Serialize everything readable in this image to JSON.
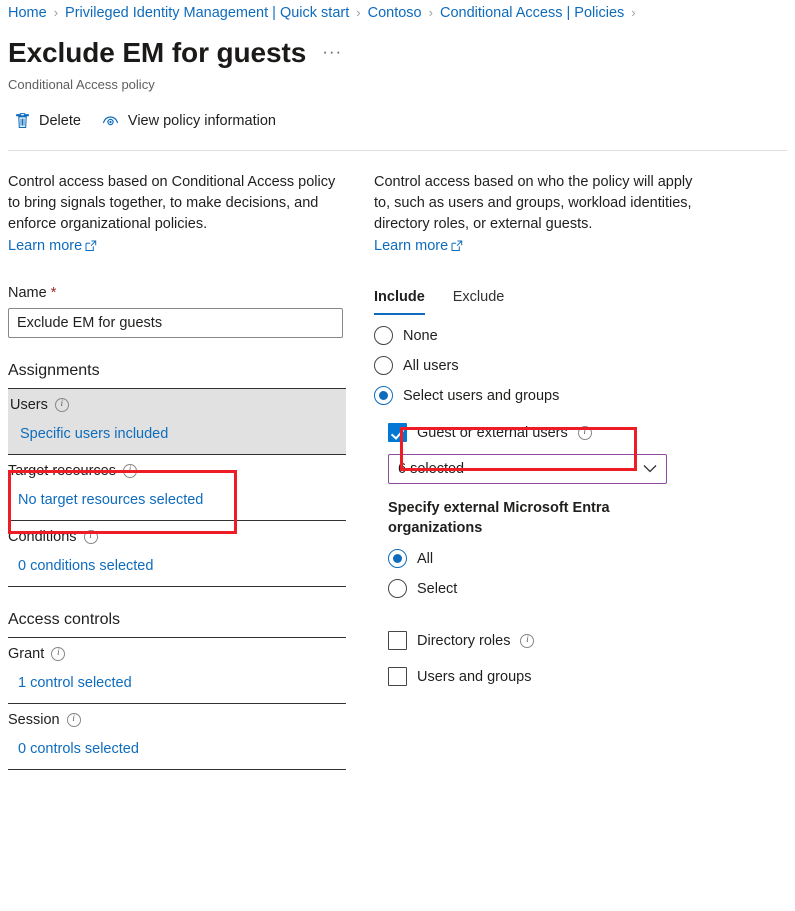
{
  "breadcrumb": {
    "items": [
      "Home",
      "Privileged Identity Management | Quick start",
      "Contoso",
      "Conditional Access | Policies"
    ],
    "separator": "›",
    "trailing_separator": "›"
  },
  "header": {
    "title": "Exclude EM for guests",
    "more_label": "···",
    "subtitle": "Conditional Access policy"
  },
  "commandbar": {
    "delete_label": "Delete",
    "view_policy_label": "View policy information"
  },
  "left": {
    "description": "Control access based on Conditional Access policy to bring signals together, to make decisions, and enforce organizational policies.",
    "learn_more": "Learn more",
    "name_label": "Name",
    "name_required": "*",
    "name_value": "Exclude EM for guests",
    "assignments_heading": "Assignments",
    "rows": [
      {
        "label": "Users",
        "value": "Specific users included"
      },
      {
        "label": "Target resources",
        "value": "No target resources selected"
      },
      {
        "label": "Conditions",
        "value": "0 conditions selected"
      }
    ],
    "access_controls_heading": "Access controls",
    "control_rows": [
      {
        "label": "Grant",
        "value": "1 control selected"
      },
      {
        "label": "Session",
        "value": "0 controls selected"
      }
    ]
  },
  "right": {
    "description": "Control access based on who the policy will apply to, such as users and groups, workload identities, directory roles, or external guests.",
    "learn_more": "Learn more",
    "tabs": [
      {
        "label": "Include",
        "active": true
      },
      {
        "label": "Exclude",
        "active": false
      }
    ],
    "radios": [
      {
        "label": "None",
        "checked": false
      },
      {
        "label": "All users",
        "checked": false
      },
      {
        "label": "Select users and groups",
        "checked": true
      }
    ],
    "guest_checkbox_label": "Guest or external users",
    "guest_dropdown_value": "6 selected",
    "dropdown_chevron": "⌄",
    "specify_heading": "Specify external Microsoft Entra organizations",
    "org_radios": [
      {
        "label": "All",
        "checked": true
      },
      {
        "label": "Select",
        "checked": false
      }
    ],
    "extra_checkboxes": [
      {
        "label": "Directory roles",
        "has_info": true,
        "checked": false
      },
      {
        "label": "Users and groups",
        "has_info": false,
        "checked": false
      }
    ]
  },
  "colors": {
    "link": "#0f6cbd",
    "accent": "#0078d4",
    "annotation": "#ee1c25",
    "dropdown_border": "#8e4a9e",
    "required": "#a4262c"
  },
  "icons": {
    "info": "ℹ",
    "external_link": "external-link-icon",
    "trash": "trash-icon",
    "eye": "eye-icon"
  }
}
